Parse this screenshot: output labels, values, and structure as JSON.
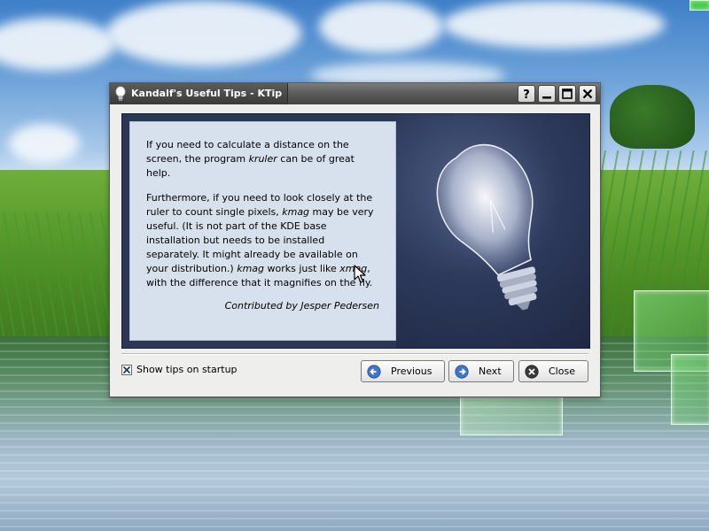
{
  "window": {
    "title": "Kandalf's Useful Tips - KTip",
    "titlebar_buttons": [
      "help-icon",
      "minimize-icon",
      "maximize-icon",
      "close-icon"
    ]
  },
  "tip": {
    "p1_a": "If you need to calculate a distance on the screen, the program ",
    "p1_em": "kruler",
    "p1_b": " can be of great help.",
    "p2_a": "Furthermore, if you need to look closely at the ruler to count single pixels, ",
    "p2_em1": "kmag",
    "p2_b": " may be very useful. (It is not part of the KDE base installation but needs to be installed separately. It might already be available on your distribution.) ",
    "p2_em2": "kmag",
    "p2_c": " works just like ",
    "p2_em3": "xmag",
    "p2_d": ", with the difference that it magnifies on the fly.",
    "contributor": "Contributed by Jesper Pedersen",
    "image": "lightbulb-image"
  },
  "options": {
    "show_tips_label": "Show tips on startup",
    "show_tips_checked": true
  },
  "buttons": {
    "previous": "Previous",
    "next": "Next",
    "close": "Close"
  },
  "colors": {
    "titlebar": "#5a5a5a",
    "tip_background": "#d7e1ee",
    "image_background": "#2b3854"
  }
}
